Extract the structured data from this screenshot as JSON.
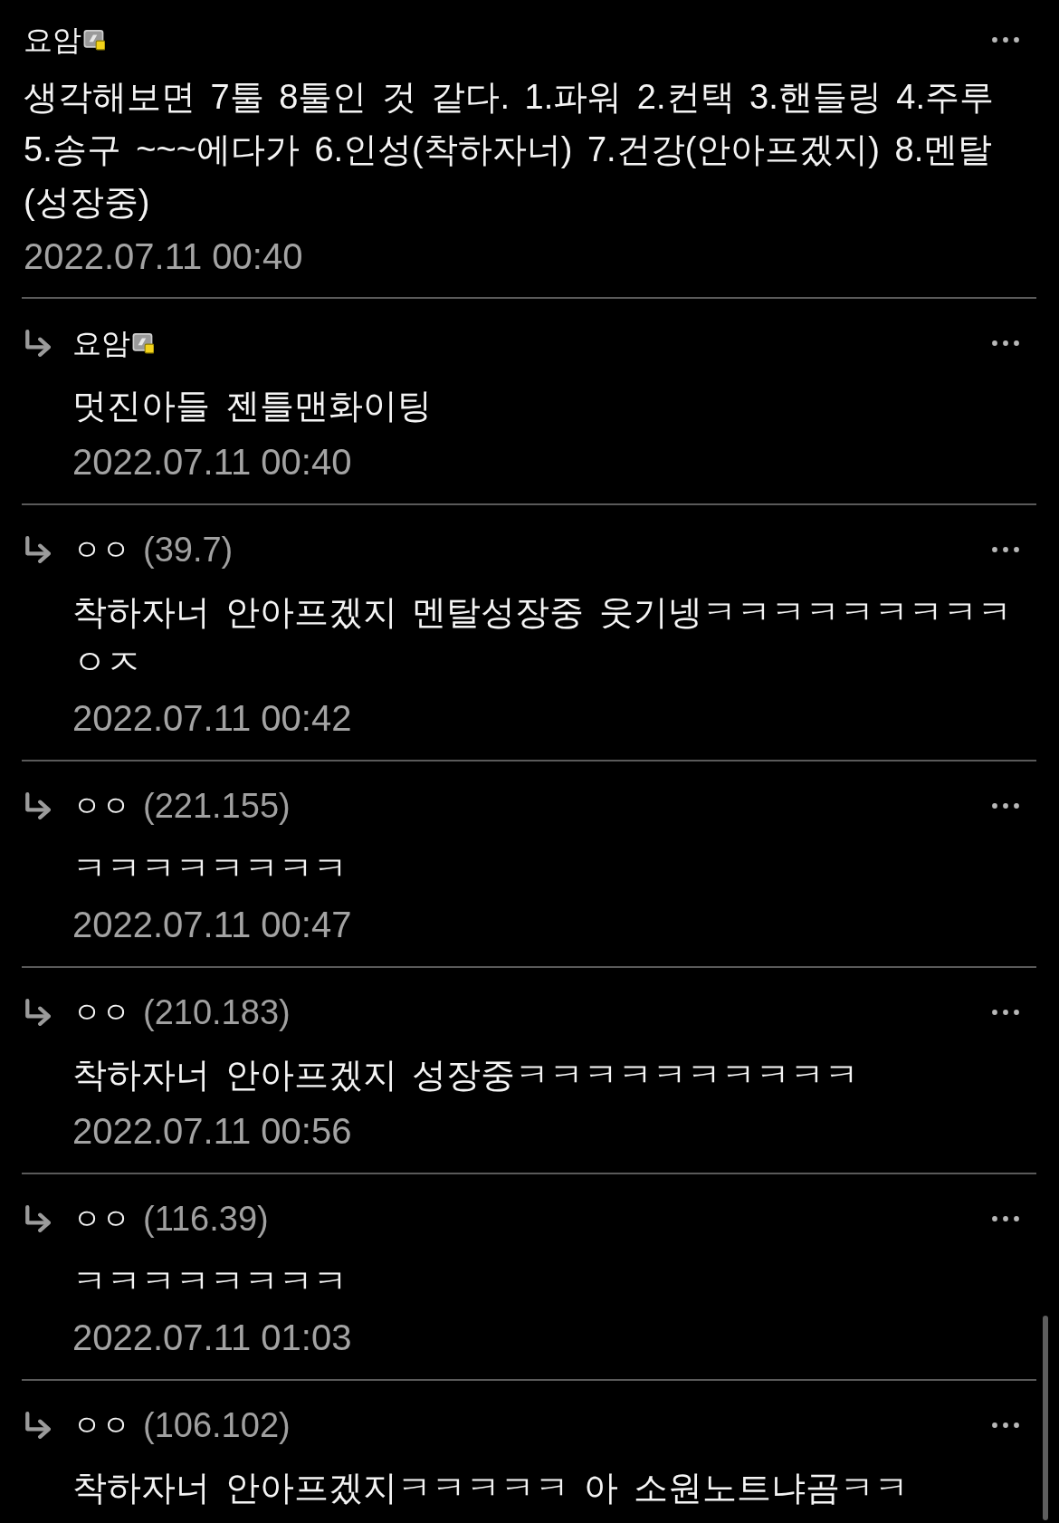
{
  "comments": [
    {
      "kind": "comment",
      "author": "요암",
      "nick_icon": true,
      "text": "생각해보면 7툴 8툴인 것 같다. 1.파워 2.컨택 3.핸들링 4.주루 5.송구 ~~~에다가 6.인성(착하자너) 7.건강(안아프겠지) 8.멘탈 (성장중)",
      "date": "2022.07.11 00:40"
    },
    {
      "kind": "reply",
      "author": "요암",
      "nick_icon": true,
      "text": "멋진아들 젠틀맨화이팅",
      "date": "2022.07.11 00:40"
    },
    {
      "kind": "reply",
      "author": "ㅇㅇ",
      "nick_icon": false,
      "ip": "(39.7)",
      "text": "착하자너 안아프겠지 멘탈성장중 웃기넹ㅋㅋㅋㅋㅋㅋㅋㅋㅋㅇㅈ",
      "date": "2022.07.11 00:42"
    },
    {
      "kind": "reply",
      "author": "ㅇㅇ",
      "nick_icon": false,
      "ip": "(221.155)",
      "text": "ㅋㅋㅋㅋㅋㅋㅋㅋ",
      "date": "2022.07.11 00:47"
    },
    {
      "kind": "reply",
      "author": "ㅇㅇ",
      "nick_icon": false,
      "ip": "(210.183)",
      "text": "착하자너 안아프겠지 성장중ㅋㅋㅋㅋㅋㅋㅋㅋㅋㅋ",
      "date": "2022.07.11 00:56"
    },
    {
      "kind": "reply",
      "author": "ㅇㅇ",
      "nick_icon": false,
      "ip": "(116.39)",
      "text": "ㅋㅋㅋㅋㅋㅋㅋㅋ",
      "date": "2022.07.11 01:03"
    },
    {
      "kind": "reply",
      "author": "ㅇㅇ",
      "nick_icon": false,
      "ip": "(106.102)",
      "text": "착하자너 안아프겠지ㅋㅋㅋㅋㅋ 아 소원노트냐곰ㅋㅋ"
    }
  ]
}
